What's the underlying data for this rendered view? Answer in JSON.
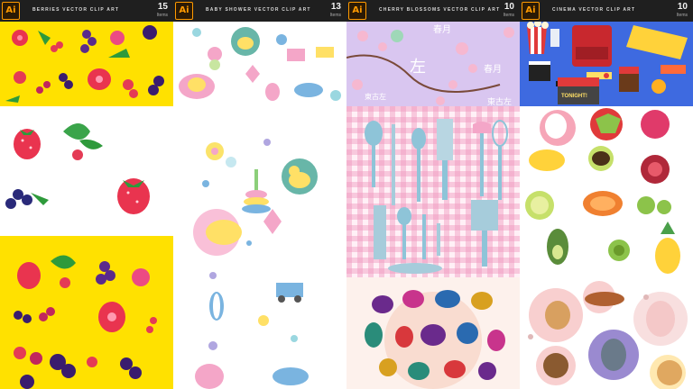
{
  "app_icon_label": "Ai",
  "cards": [
    {
      "title": "BERRIES VECTOR CLIP ART",
      "count": "15",
      "items_label": "Items"
    },
    {
      "title": "BABY SHOWER VECTOR CLIP ART",
      "count": "13",
      "items_label": "Items"
    },
    {
      "title": "CHERRY BLOSSOMS VECTOR CLIP ART",
      "count": "10",
      "items_label": "Items"
    },
    {
      "title": "CINEMA VECTOR CLIP ART",
      "count": "10",
      "items_label": "Items"
    }
  ],
  "cinema_sign_text": "TONIGHT!",
  "cherry_kanji": [
    "春月",
    "左",
    "春月",
    "東古左",
    "東古左"
  ],
  "colors": {
    "header_bg": "#1f1f1f",
    "ai_orange": "#ff9a00",
    "berries_yellow": "#ffe100",
    "baby_bg": "#ffffff",
    "cherry_lavender": "#d9c6f0",
    "gingham_pink": "#f7c9dd",
    "cinema_blue": "#3e6ae0"
  }
}
